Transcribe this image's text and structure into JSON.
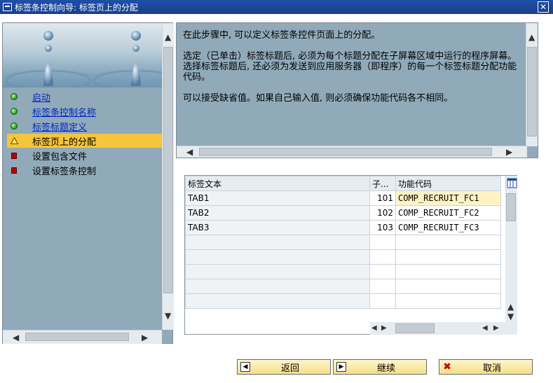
{
  "window": {
    "title": "标签条控制向导: 标签页上的分配",
    "close_glyph": "✕"
  },
  "steps": [
    {
      "label": "启动",
      "state": "done"
    },
    {
      "label": "标签条控制名称",
      "state": "done"
    },
    {
      "label": "标签标题定义",
      "state": "done"
    },
    {
      "label": "标签页上的分配",
      "state": "current"
    },
    {
      "label": "设置包含文件",
      "state": "todo"
    },
    {
      "label": "设置标签条控制",
      "state": "todo"
    }
  ],
  "info": {
    "p1": "在此步骤中, 可以定义标签条控件页面上的分配。",
    "p2": "选定（已单击）标签标题后, 必须为每个标题分配在子屏幕区域中运行的程序屏幕。",
    "p3": "选择标签标题后, 还必须为发送到应用服务器（即程序）的每一个标签标题分配功能代码。",
    "p4": "可以接受缺省值。如果自己输入值, 则必须确保功能代码各不相同。"
  },
  "table": {
    "headers": [
      "标签文本",
      "子...",
      "功能代码"
    ],
    "rows": [
      [
        "TAB1",
        "101",
        "COMP_RECRUIT_FC1"
      ],
      [
        "TAB2",
        "102",
        "COMP_RECRUIT_FC2"
      ],
      [
        "TAB3",
        "103",
        "COMP_RECRUIT_FC3"
      ]
    ]
  },
  "buttons": {
    "back": "返回",
    "continue": "继续",
    "cancel": "取消"
  },
  "icons": {
    "step_done": "green-dot-icon",
    "step_current": "warning-triangle-icon",
    "step_todo": "red-square-icon"
  },
  "colors": {
    "title_bar": "#1f4fa7",
    "panel": "#91aab9",
    "current_step": "#f7c53a",
    "link": "#0026c8"
  }
}
